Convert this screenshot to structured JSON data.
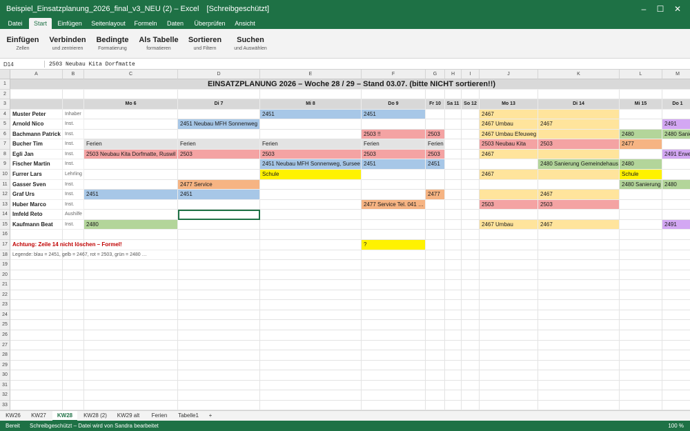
{
  "window": {
    "title": "Beispiel_Einsatzplanung_2026_final_v3_NEU (2) – Excel",
    "mode": "[Schreibgeschützt]",
    "min_glyph": "–",
    "max_glyph": "☐",
    "close_glyph": "✕"
  },
  "menu": [
    "Datei",
    "Start",
    "Einfügen",
    "Seitenlayout",
    "Formeln",
    "Daten",
    "Überprüfen",
    "Ansicht"
  ],
  "ribbon": [
    {
      "big": "Einfügen",
      "small": "Zellen"
    },
    {
      "big": "Verbinden",
      "small": "und zentrieren"
    },
    {
      "big": "Bedingte",
      "small": "Formatierung"
    },
    {
      "big": "Als Tabelle",
      "small": "formatieren"
    },
    {
      "big": "Sortieren",
      "small": "und Filtern"
    },
    {
      "big": "Suchen",
      "small": "und Auswählen"
    }
  ],
  "formula": {
    "namebox": "D14",
    "content": "2503 Neubau Kita Dorfmatte"
  },
  "columns": [
    "A",
    "B",
    "C",
    "D",
    "E",
    "F",
    "G",
    "H",
    "I",
    "J",
    "K",
    "L",
    "M"
  ],
  "rows": [
    "1",
    "2",
    "3",
    "4",
    "5",
    "6",
    "7",
    "8",
    "9",
    "10",
    "11",
    "12",
    "13",
    "14",
    "15",
    "16",
    "17",
    "18",
    "19",
    "20",
    "21",
    "22",
    "23",
    "24",
    "25",
    "26",
    "27",
    "28",
    "29",
    "30",
    "31",
    "32",
    "33"
  ],
  "sheet": {
    "title": "EINSATZPLANUNG 2026  –  Woche 28 / 29  –  Stand 03.07. (bitte NICHT sortieren!!)",
    "days": [
      "Mo 6",
      "Di 7",
      "Mi 8",
      "Do 9",
      "Fr 10",
      "Sa 11",
      "So 12",
      "Mo 13",
      "Di 14",
      "Mi 15",
      "Do 1"
    ],
    "employees": [
      {
        "name": "Muster Peter",
        "role": "Inhaber"
      },
      {
        "name": "Arnold Nico",
        "role": "Inst."
      },
      {
        "name": "Bachmann Patrick",
        "role": "Inst."
      },
      {
        "name": "Bucher Tim",
        "role": "Inst."
      },
      {
        "name": "Egli Jan",
        "role": "Inst."
      },
      {
        "name": "Fischer Martin",
        "role": "Inst."
      },
      {
        "name": "Furrer Lars",
        "role": "Lehrling"
      },
      {
        "name": "Gasser Sven",
        "role": "Inst."
      },
      {
        "name": "Graf Urs",
        "role": "Inst."
      },
      {
        "name": "Huber Marco",
        "role": "Inst."
      },
      {
        "name": "Imfeld Reto",
        "role": "Aushilfe"
      },
      {
        "name": "Kaufmann Beat",
        "role": "Inst."
      }
    ],
    "entries": {
      "r4": {
        "E": "2451",
        "F": "2451",
        "J": "2467"
      },
      "r5": {
        "D": "2451 Neubau MFH Sonnenweg",
        "J": "2467 Umbau",
        "K": "2467",
        "M": "2491"
      },
      "r6": {
        "F": "2503 !!",
        "G": "2503",
        "J": "2467 Umbau Efeuweg",
        "L": "2480",
        "M": "2480 Sanie"
      },
      "r7": {
        "C": "Ferien",
        "D": "Ferien",
        "E": "Ferien",
        "F": "Ferien",
        "G": "Ferien",
        "J": "2503 Neubau Kita",
        "K": "2503",
        "L": "2477"
      },
      "r8": {
        "C": "2503 Neubau Kita Dorfmatte, Ruswil",
        "D": "2503",
        "E": "2503",
        "F": "2503",
        "G": "2503",
        "J": "2467",
        "M": "2491 Erwe"
      },
      "r9": {
        "E": "2451 Neubau MFH Sonnenweg, Sursee",
        "F": "2451",
        "G": "2451",
        "K": "2480 Sanierung Gemeindehaus",
        "L": "2480"
      },
      "r10": {
        "E": "Schule",
        "J": "2467",
        "L": "Schule"
      },
      "r11": {
        "D": "2477 Service",
        "L": "2480 Sanierung",
        "M": "2480"
      },
      "r12": {
        "C": "2451",
        "D": "2451",
        "G": "2477",
        "K": "2467"
      },
      "r13": {
        "F": "2477 Service Tel. 041 …",
        "J": "2503",
        "K": "2503"
      },
      "r15": {
        "C": "2480",
        "J": "2467 Umbau",
        "K": "2467",
        "M": "2491"
      }
    },
    "warning": "Achtung: Zeile 14 nicht löschen – Formel!",
    "question": "?",
    "legend": "Legende: blau = 2451, gelb = 2467, rot = 2503, grün = 2480 …"
  },
  "sheets": [
    "KW26",
    "KW27",
    "KW28",
    "KW28 (2)",
    "KW29 alt",
    "Ferien",
    "Tabelle1",
    "+"
  ],
  "active_sheet": "KW28",
  "status": {
    "ready": "Bereit",
    "info": "Schreibgeschützt – Datei wird von Sandra bearbeitet",
    "zoom": "100 %"
  },
  "colors": {
    "brand": "#1e7145",
    "blue": "#a7c7e7",
    "yellow": "#fff200",
    "light_yellow": "#ffe49c",
    "red": "#f4a3a3",
    "green": "#b3d59a",
    "orange": "#f6b483",
    "purple": "#d3a7f3"
  }
}
